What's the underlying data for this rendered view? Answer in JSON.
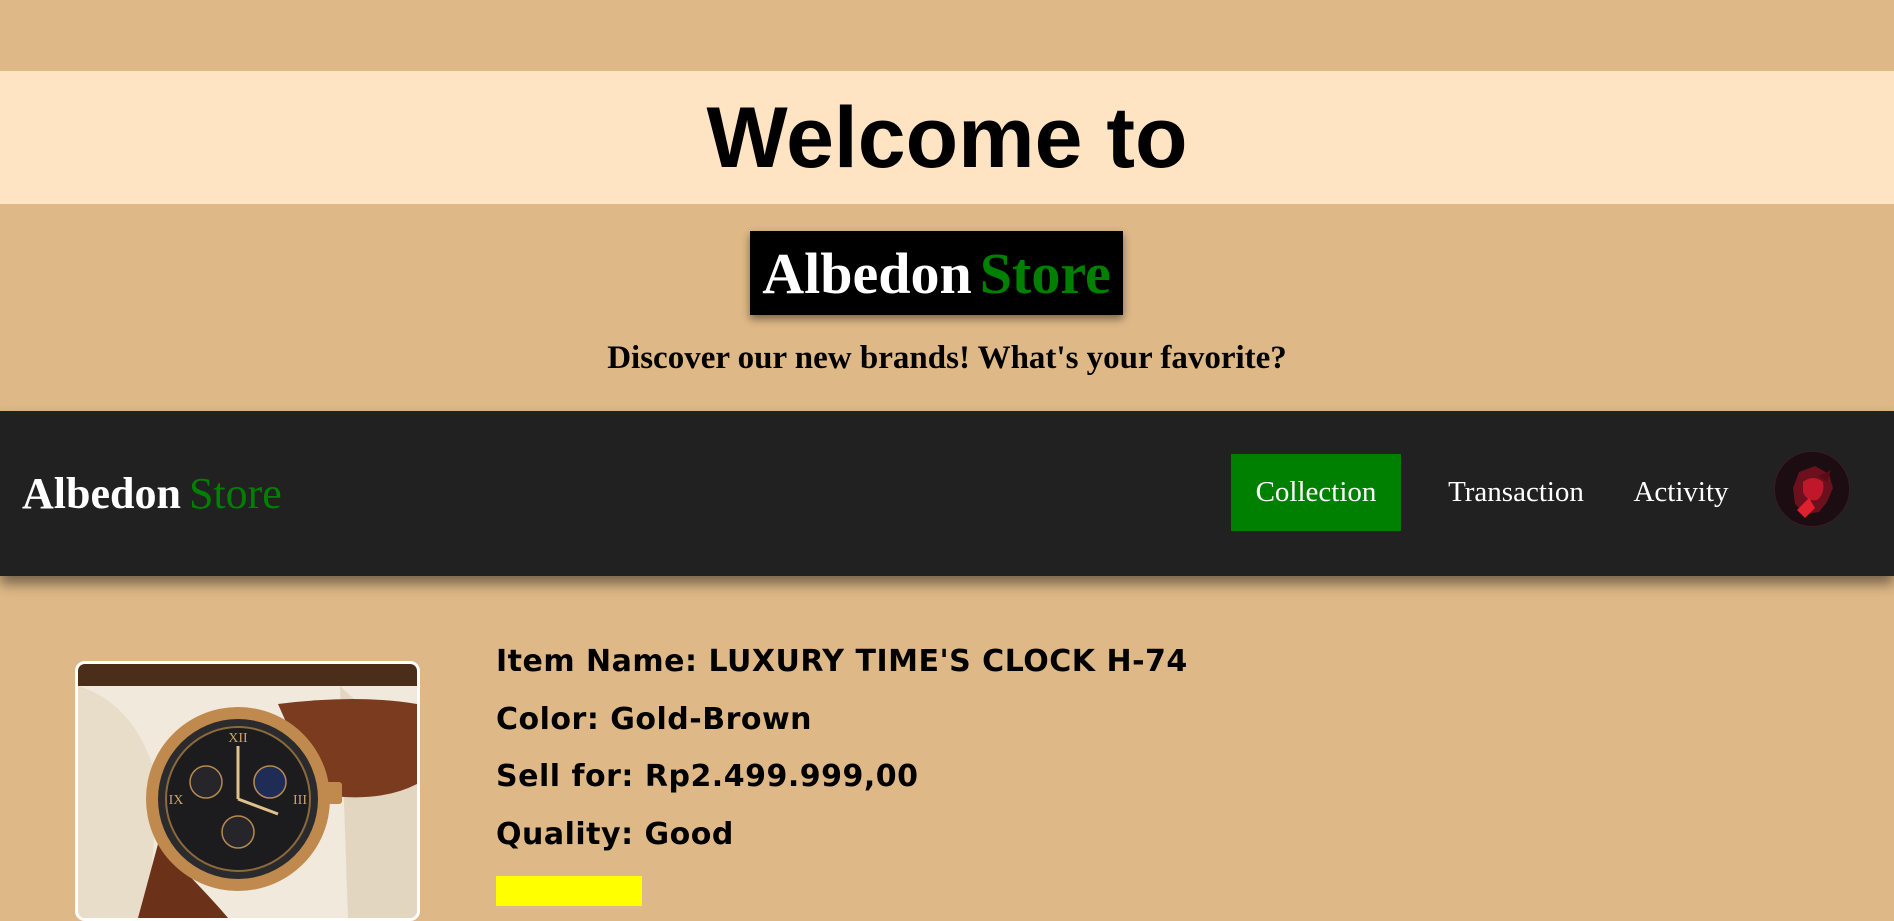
{
  "hero": {
    "welcome": "Welcome to",
    "brand_first": "Albedon",
    "brand_second": "Store",
    "tagline": "Discover our new brands! What's your favorite?"
  },
  "navbar": {
    "brand_first": "Albedon",
    "brand_second": "Store",
    "items": [
      {
        "label": "Collection",
        "active": true
      },
      {
        "label": "Transaction",
        "active": false
      },
      {
        "label": "Activity",
        "active": false
      }
    ],
    "avatar_icon": "user-avatar"
  },
  "product": {
    "image_icon": "wristwatch-image",
    "name": "Item Name: LUXURY TIME'S CLOCK H-74",
    "color": "Color: Gold-Brown",
    "price": "Sell for: Rp2.499.999,00",
    "quality": "Quality: Good",
    "action_button_label": ""
  },
  "colors": {
    "page_bg": "#deb887",
    "welcome_band": "#ffe4c4",
    "navbar_bg": "#212121",
    "accent_green": "#008000",
    "button_yellow": "#ffff00"
  }
}
